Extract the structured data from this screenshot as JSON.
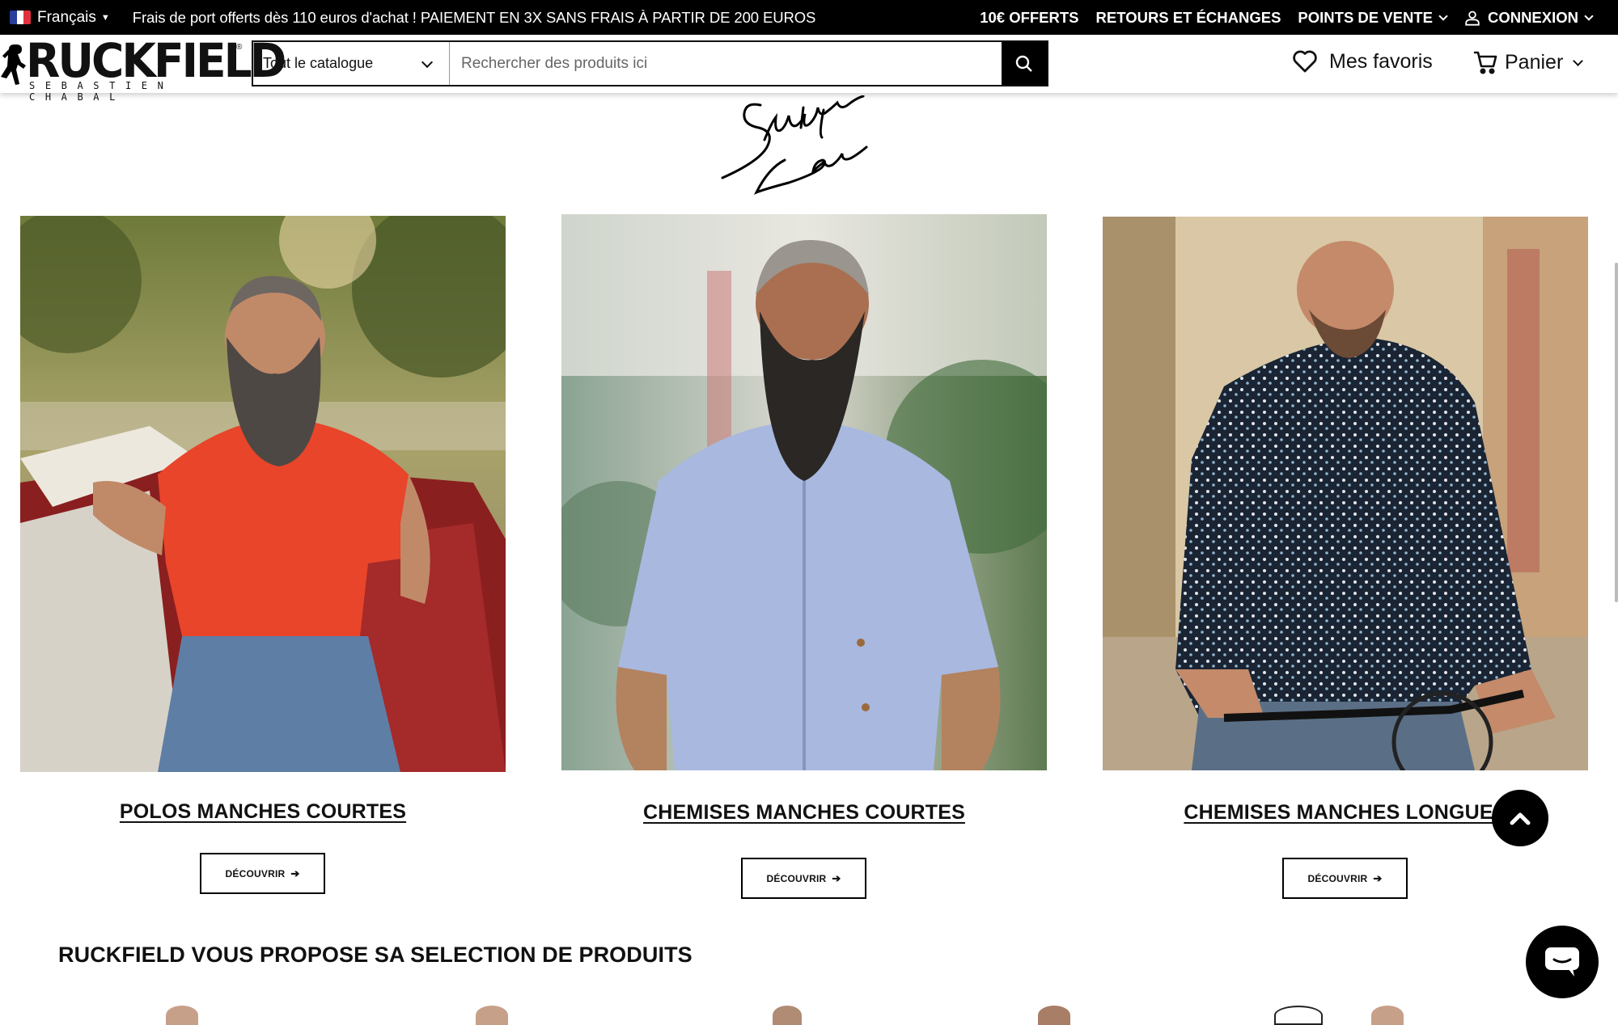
{
  "topbar": {
    "language": "Français",
    "promo": "Frais de port offerts dès 110 euros d'achat ! PAIEMENT EN 3X SANS FRAIS À PARTIR DE 200 EUROS",
    "links": {
      "offer": "10€ OFFERTS",
      "returns": "RETOURS ET ÉCHANGES",
      "stores": "POINTS DE VENTE",
      "login": "CONNEXION"
    }
  },
  "header": {
    "logo": {
      "brand": "RUCKFIELD",
      "subtitle": "SEBASTIEN CHABAL",
      "mark": "®"
    },
    "search": {
      "category": "Tout le catalogue",
      "placeholder": "Rechercher des produits ici"
    },
    "favorites": "Mes favoris",
    "cart": "Panier"
  },
  "signature_text": "Sebastien Chabal",
  "products": [
    {
      "title": "POLOS MANCHES COURTES",
      "button": "DÉCOUVRIR"
    },
    {
      "title": "CHEMISES MANCHES COURTES",
      "button": "DÉCOUVRIR"
    },
    {
      "title": "CHEMISES MANCHES LONGUES",
      "button": "DÉCOUVRIR"
    }
  ],
  "selection_title": "RUCKFIELD VOUS PROPOSE SA SELECTION DE PRODUITS",
  "colors": {
    "topbar_bg": "#000000",
    "accent": "#000000",
    "polo": "#e8452a",
    "shirt_light": "#a9b8df",
    "shirt_dark": "#1a2433"
  },
  "icons": [
    "user-icon",
    "search-icon",
    "heart-icon",
    "cart-icon",
    "chevron-down-icon",
    "arrow-up-icon",
    "chat-icon"
  ]
}
